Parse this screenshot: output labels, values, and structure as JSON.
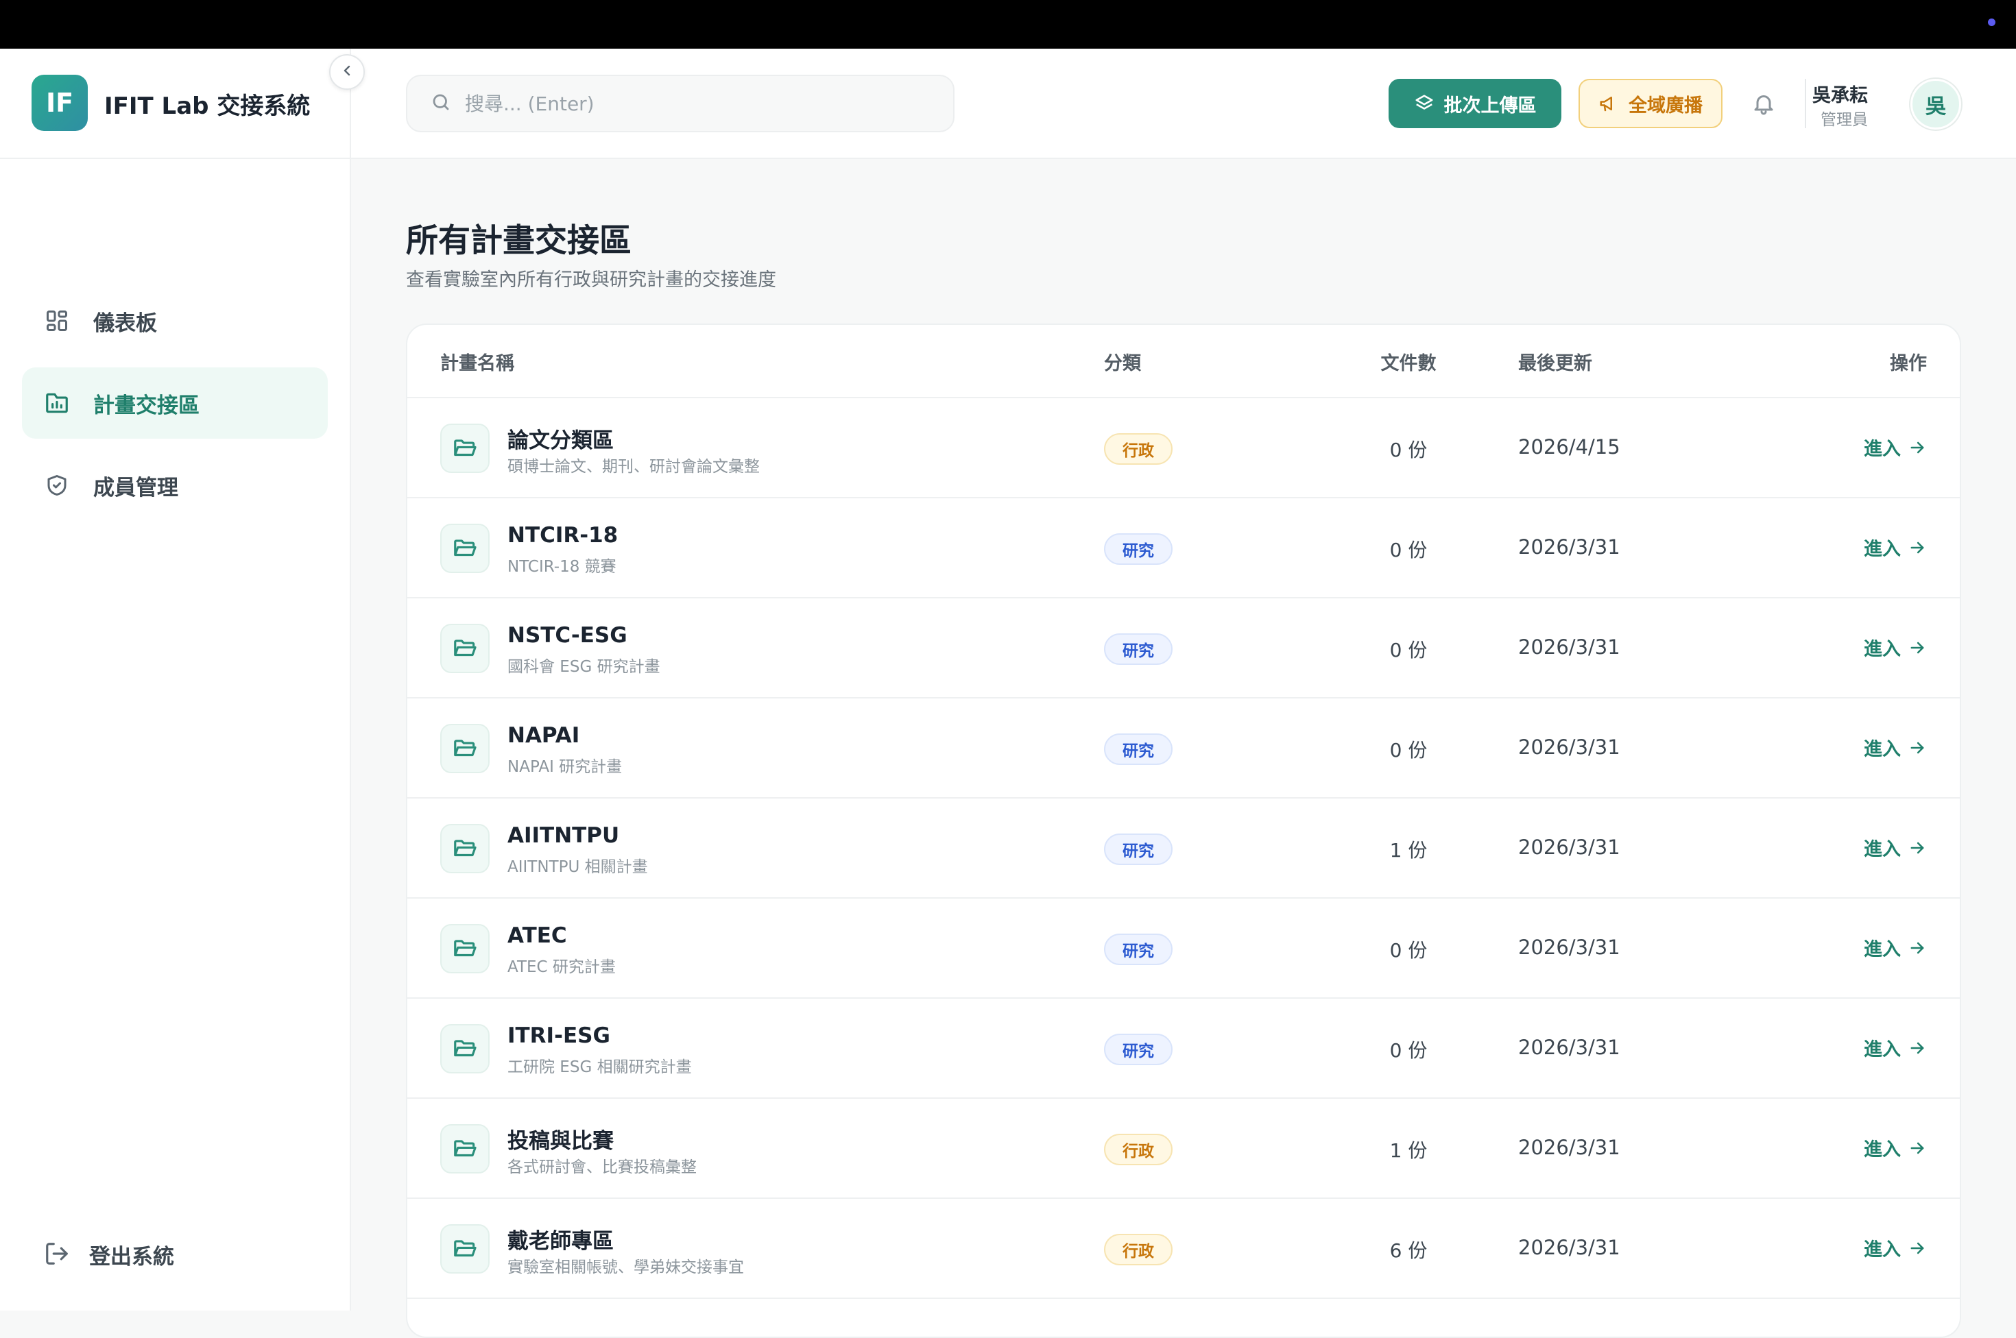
{
  "brand": {
    "logo_text": "IF",
    "title": "IFIT Lab 交接系統"
  },
  "sidebar": {
    "items": [
      {
        "label": "儀表板",
        "icon": "dashboard-icon"
      },
      {
        "label": "計畫交接區",
        "icon": "folder-chart-icon",
        "active": true
      },
      {
        "label": "成員管理",
        "icon": "shield-check-icon"
      }
    ],
    "logout_label": "登出系統"
  },
  "header": {
    "search_placeholder": "搜尋... (Enter)",
    "batch_upload_label": "批次上傳區",
    "broadcast_label": "全域廣播",
    "user": {
      "name": "吳承耘",
      "role": "管理員",
      "avatar_text": "吳"
    }
  },
  "main": {
    "title": "所有計畫交接區",
    "subtitle": "查看實驗室內所有行政與研究計畫的交接進度",
    "columns": [
      "計畫名稱",
      "分類",
      "文件數",
      "最後更新",
      "操作"
    ],
    "enter_label": "進入",
    "rows": [
      {
        "name": "論文分類區",
        "desc": "碩博士論文、期刊、研討會論文彙整",
        "category": "行政",
        "docs": "0 份",
        "updated": "2026/4/15"
      },
      {
        "name": "NTCIR-18",
        "desc": "NTCIR-18 競賽",
        "category": "研究",
        "docs": "0 份",
        "updated": "2026/3/31"
      },
      {
        "name": "NSTC-ESG",
        "desc": "國科會 ESG 研究計畫",
        "category": "研究",
        "docs": "0 份",
        "updated": "2026/3/31"
      },
      {
        "name": "NAPAI",
        "desc": "NAPAI 研究計畫",
        "category": "研究",
        "docs": "0 份",
        "updated": "2026/3/31"
      },
      {
        "name": "AIITNTPU",
        "desc": "AIITNTPU 相關計畫",
        "category": "研究",
        "docs": "1 份",
        "updated": "2026/3/31"
      },
      {
        "name": "ATEC",
        "desc": "ATEC 研究計畫",
        "category": "研究",
        "docs": "0 份",
        "updated": "2026/3/31"
      },
      {
        "name": "ITRI-ESG",
        "desc": "工研院 ESG 相關研究計畫",
        "category": "研究",
        "docs": "0 份",
        "updated": "2026/3/31"
      },
      {
        "name": "投稿與比賽",
        "desc": "各式研討會、比賽投稿彙整",
        "category": "行政",
        "docs": "1 份",
        "updated": "2026/3/31"
      },
      {
        "name": "戴老師專區",
        "desc": "實驗室相關帳號、學弟妹交接事宜",
        "category": "行政",
        "docs": "6 份",
        "updated": "2026/3/31"
      }
    ]
  },
  "colors": {
    "accent": "#2a8f7b",
    "admin_badge": "#c7760b",
    "research_badge": "#2d5bd1",
    "broadcast_bg": "#fff7e0"
  }
}
